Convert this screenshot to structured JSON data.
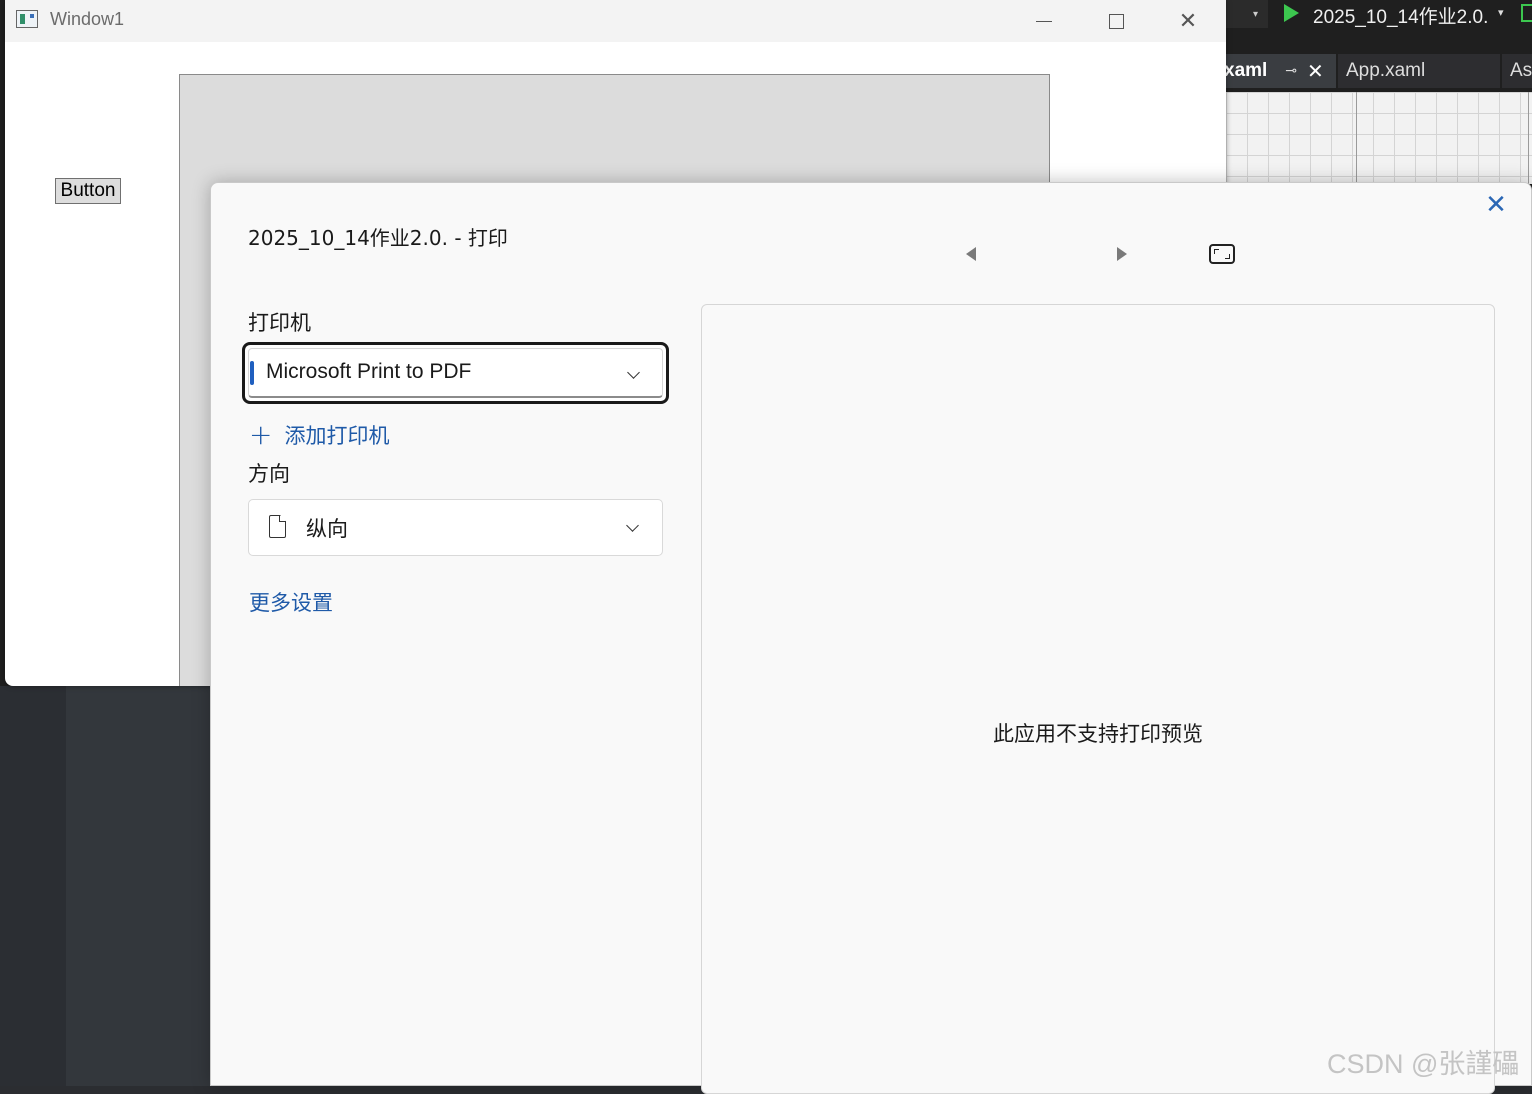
{
  "ide": {
    "project_label": "2025_10_14作业2.0.",
    "tabs": [
      {
        "label": "xaml"
      },
      {
        "label": "App.xaml"
      },
      {
        "label": "As"
      }
    ],
    "pin_glyph": "⊸",
    "close_glyph": "✕",
    "dropdown_glyph": "▾"
  },
  "window1": {
    "title": "Window1",
    "button_label": "Button",
    "close_glyph": "✕"
  },
  "print_dialog": {
    "title": "2025_10_14作业2.0. - 打印",
    "close_glyph": "✕",
    "printer_label": "打印机",
    "printer_value": "Microsoft Print to PDF",
    "add_printer_plus": "+",
    "add_printer_label": "添加打印机",
    "orientation_label": "方向",
    "orientation_value": "纵向",
    "more_settings_label": "更多设置",
    "preview_message": "此应用不支持打印预览"
  },
  "watermark": "CSDN @张謹礧",
  "colors": {
    "accent_blue": "#1f5aa8",
    "run_green": "#3cc74f"
  }
}
